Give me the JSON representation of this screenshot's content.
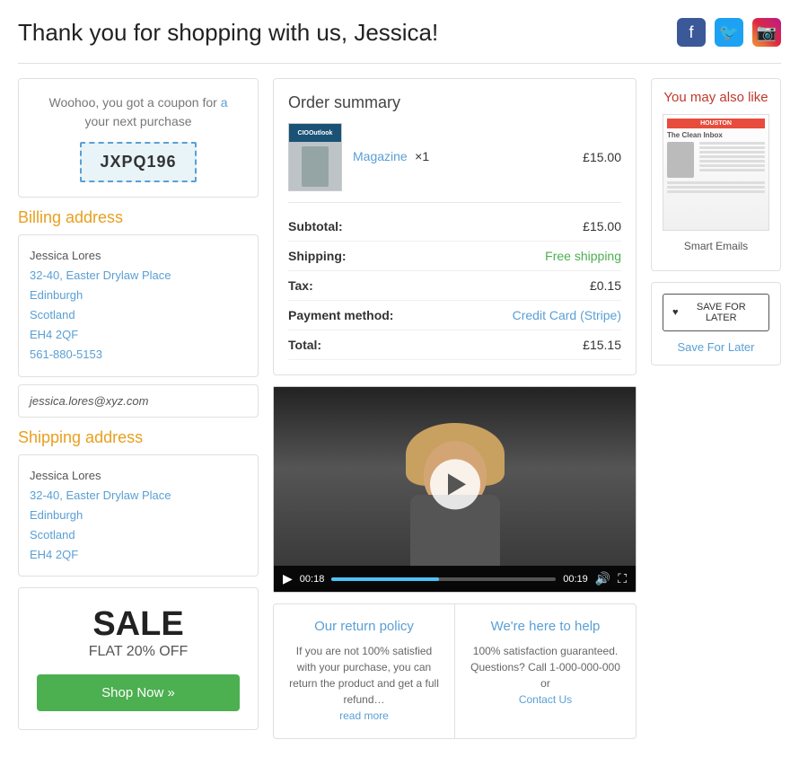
{
  "header": {
    "title": "Thank you for shopping with us, Jessica!",
    "social": {
      "facebook_label": "Facebook",
      "twitter_label": "Twitter",
      "instagram_label": "Instagram"
    }
  },
  "coupon": {
    "text_line1": "Woohoo, you got a coupon for",
    "text_link": "a",
    "text_line2": "your next purchase",
    "code": "JXPQ196"
  },
  "billing": {
    "title": "Billing address",
    "name": "Jessica Lores",
    "address1": "32-40, Easter Drylaw Place",
    "city": "Edinburgh",
    "region": "Scotland",
    "postcode": "EH4 2QF",
    "phone": "561-880-5153",
    "email": "jessica.lores@xyz.com"
  },
  "shipping": {
    "title": "Shipping address",
    "name": "Jessica Lores",
    "address1": "32-40, Easter Drylaw Place",
    "city": "Edinburgh",
    "region": "Scotland",
    "postcode": "EH4 2QF"
  },
  "sale": {
    "title": "SALE",
    "subtitle": "FLAT 20% OFF",
    "button": "Shop Now »"
  },
  "order_summary": {
    "title": "Order summary",
    "item_name": "Magazine",
    "item_qty": "×1",
    "item_price": "£15.00",
    "rows": [
      {
        "label": "Subtotal:",
        "value": "£15.00",
        "style": "normal"
      },
      {
        "label": "Shipping:",
        "value": "Free shipping",
        "style": "green"
      },
      {
        "label": "Tax:",
        "value": "£0.15",
        "style": "normal"
      },
      {
        "label": "Payment method:",
        "value": "Credit Card (Stripe)",
        "style": "blue"
      },
      {
        "label": "Total:",
        "value": "£15.15",
        "style": "normal"
      }
    ]
  },
  "video": {
    "time_current": "00:18",
    "time_total": "00:19"
  },
  "policy": {
    "return": {
      "title": "Our return policy",
      "text": "If you are not 100% satisfied with your purchase, you can return the product and get a full refund…",
      "read_more": "read more"
    },
    "help": {
      "title": "We're here to help",
      "text": "100% satisfaction guaranteed. Questions? Call 1-000-000-000 or",
      "contact_link": "Contact Us"
    }
  },
  "also_like": {
    "title": "You may also like",
    "item_name": "Smart Emails",
    "img_header": "HOUSTON",
    "img_subtitle": "The Clean Inbox"
  },
  "save_later": {
    "button": "SAVE FOR LATER",
    "label": "Save For Later"
  }
}
